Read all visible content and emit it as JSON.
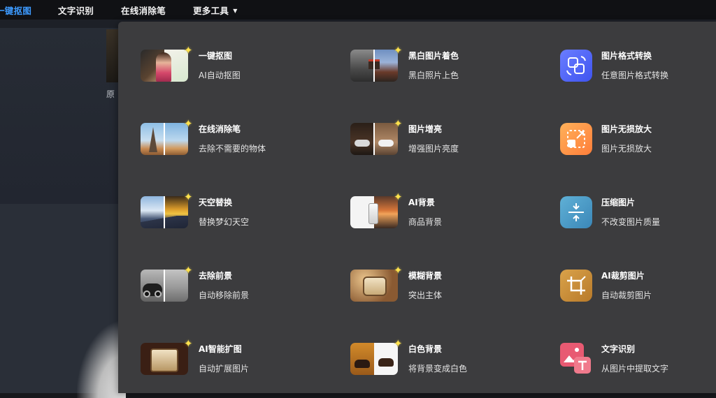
{
  "nav": {
    "items": [
      {
        "label": "一键抠图",
        "active": true
      },
      {
        "label": "文字识别",
        "active": false
      },
      {
        "label": "在线消除笔",
        "active": false
      },
      {
        "label": "更多工具",
        "active": false,
        "has_caret": true
      }
    ],
    "caret_icon": "caret-down-icon"
  },
  "background": {
    "partial_label": "原"
  },
  "colors": {
    "active_nav": "#3d9bff",
    "dropdown_bg": "#3c3c3e",
    "sparkle": "#ffe24d"
  },
  "tools": [
    {
      "title": "一键抠图",
      "desc": "AI自动抠图",
      "icon": "cutout-thumb"
    },
    {
      "title": "黑白图片着色",
      "desc": "黑白照片上色",
      "icon": "colorize-thumb"
    },
    {
      "title": "图片格式转换",
      "desc": "任意图片格式转换",
      "icon": "format-convert-icon"
    },
    {
      "title": "在线消除笔",
      "desc": "去除不需要的物体",
      "icon": "eraser-thumb"
    },
    {
      "title": "图片增亮",
      "desc": "增强图片亮度",
      "icon": "brighten-thumb"
    },
    {
      "title": "图片无损放大",
      "desc": "图片无损放大",
      "icon": "upscale-icon"
    },
    {
      "title": "天空替换",
      "desc": "替换梦幻天空",
      "icon": "sky-thumb"
    },
    {
      "title": "AI背景",
      "desc": "商品背景",
      "icon": "ai-background-thumb"
    },
    {
      "title": "压缩图片",
      "desc": "不改变图片质量",
      "icon": "compress-icon"
    },
    {
      "title": "去除前景",
      "desc": "自动移除前景",
      "icon": "remove-foreground-thumb"
    },
    {
      "title": "模糊背景",
      "desc": "突出主体",
      "icon": "blur-background-thumb"
    },
    {
      "title": "AI裁剪图片",
      "desc": "自动裁剪图片",
      "icon": "crop-icon"
    },
    {
      "title": "AI智能扩图",
      "desc": "自动扩展图片",
      "icon": "expand-thumb"
    },
    {
      "title": "白色背景",
      "desc": "将背景变成白色",
      "icon": "white-background-thumb"
    },
    {
      "title": "文字识别",
      "desc": "从图片中提取文字",
      "icon": "text-recognition-icon"
    }
  ]
}
